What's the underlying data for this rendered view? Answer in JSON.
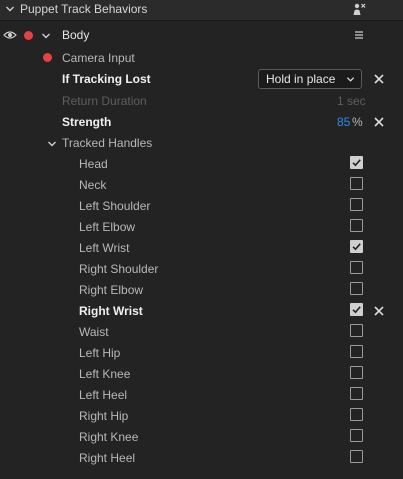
{
  "panel": {
    "title": "Puppet Track Behaviors",
    "header_icon": "puppet-figure-icon"
  },
  "layer": {
    "name": "Body",
    "record_color": "#e84143"
  },
  "camera_input": {
    "label": "Camera Input"
  },
  "if_tracking_lost": {
    "label": "If Tracking Lost",
    "value": "Hold in place"
  },
  "return_duration": {
    "label": "Return Duration",
    "value": "1 sec"
  },
  "strength": {
    "label": "Strength",
    "value": "85",
    "unit": "%",
    "value_color": "#2d8ceb"
  },
  "tracked_handles": {
    "label": "Tracked Handles",
    "items": [
      {
        "label": "Head",
        "checked": true
      },
      {
        "label": "Neck",
        "checked": false
      },
      {
        "label": "Left Shoulder",
        "checked": false
      },
      {
        "label": "Left Elbow",
        "checked": false
      },
      {
        "label": "Left Wrist",
        "checked": true
      },
      {
        "label": "Right Shoulder",
        "checked": false
      },
      {
        "label": "Right Elbow",
        "checked": false
      },
      {
        "label": "Right Wrist",
        "checked": true
      },
      {
        "label": "Waist",
        "checked": false
      },
      {
        "label": "Left Hip",
        "checked": false
      },
      {
        "label": "Left Knee",
        "checked": false
      },
      {
        "label": "Left Heel",
        "checked": false
      },
      {
        "label": "Right Hip",
        "checked": false
      },
      {
        "label": "Right Knee",
        "checked": false
      },
      {
        "label": "Right Heel",
        "checked": false
      }
    ]
  }
}
